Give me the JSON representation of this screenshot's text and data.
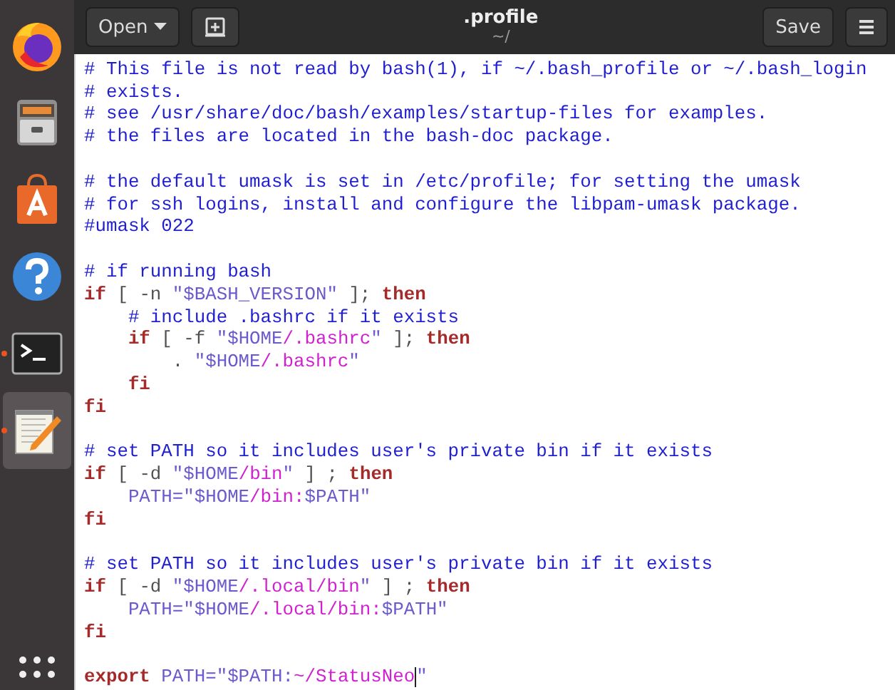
{
  "dock": {
    "items": [
      {
        "kind": "browser",
        "selected": false,
        "running": false
      },
      {
        "kind": "files",
        "selected": false,
        "running": false
      },
      {
        "kind": "software",
        "selected": false,
        "running": false
      },
      {
        "kind": "help",
        "selected": false,
        "running": false
      },
      {
        "kind": "terminal",
        "selected": false,
        "running": true
      },
      {
        "kind": "editor",
        "selected": true,
        "running": true
      }
    ],
    "apps_button": {
      "kind": "grid"
    }
  },
  "header": {
    "open_button": "Open",
    "title": ".profile",
    "subtitle": "~/",
    "save_button": "Save"
  },
  "editor": {
    "lines": [
      {
        "kind": "code",
        "segments": [
          {
            "kind": "comment",
            "text": "# This file is not read by bash(1), if ~/.bash_profile or ~/.bash_login"
          }
        ]
      },
      {
        "kind": "code",
        "segments": [
          {
            "kind": "comment",
            "text": "# exists."
          }
        ]
      },
      {
        "kind": "code",
        "segments": [
          {
            "kind": "comment",
            "text": "# see /usr/share/doc/bash/examples/startup-files for examples."
          }
        ]
      },
      {
        "kind": "code",
        "segments": [
          {
            "kind": "comment",
            "text": "# the files are located in the bash-doc package."
          }
        ]
      },
      {
        "kind": "blank"
      },
      {
        "kind": "code",
        "segments": [
          {
            "kind": "comment",
            "text": "# the default umask is set in /etc/profile; for setting the umask"
          }
        ]
      },
      {
        "kind": "code",
        "segments": [
          {
            "kind": "comment",
            "text": "# for ssh logins, install and configure the libpam-umask package."
          }
        ]
      },
      {
        "kind": "code",
        "segments": [
          {
            "kind": "comment",
            "text": "#umask 022"
          }
        ]
      },
      {
        "kind": "blank"
      },
      {
        "kind": "code",
        "segments": [
          {
            "kind": "comment",
            "text": "# if running bash"
          }
        ]
      },
      {
        "kind": "code",
        "segments": [
          {
            "kind": "keyword",
            "text": "if"
          },
          {
            "kind": "plain",
            "text": " [ -n "
          },
          {
            "kind": "variable",
            "text": "\"$BASH_VERSION\""
          },
          {
            "kind": "plain",
            "text": " ]; "
          },
          {
            "kind": "keyword",
            "text": "then"
          }
        ]
      },
      {
        "kind": "code",
        "segments": [
          {
            "kind": "comment",
            "text": "    # include .bashrc if it exists"
          }
        ]
      },
      {
        "kind": "code",
        "segments": [
          {
            "kind": "keyword",
            "text": "    if"
          },
          {
            "kind": "plain",
            "text": " [ -f "
          },
          {
            "kind": "variable",
            "text": "\"$HOME"
          },
          {
            "kind": "string",
            "text": "/.bashrc"
          },
          {
            "kind": "variable",
            "text": "\""
          },
          {
            "kind": "plain",
            "text": " ]; "
          },
          {
            "kind": "keyword",
            "text": "then"
          }
        ]
      },
      {
        "kind": "code",
        "segments": [
          {
            "kind": "plain",
            "text": "        . "
          },
          {
            "kind": "variable",
            "text": "\"$HOME"
          },
          {
            "kind": "string",
            "text": "/.bashrc"
          },
          {
            "kind": "variable",
            "text": "\""
          }
        ]
      },
      {
        "kind": "code",
        "segments": [
          {
            "kind": "keyword",
            "text": "    fi"
          }
        ]
      },
      {
        "kind": "code",
        "segments": [
          {
            "kind": "keyword",
            "text": "fi"
          }
        ]
      },
      {
        "kind": "blank"
      },
      {
        "kind": "code",
        "segments": [
          {
            "kind": "comment",
            "text": "# set PATH so it includes user's private bin if it exists"
          }
        ]
      },
      {
        "kind": "code",
        "segments": [
          {
            "kind": "keyword",
            "text": "if"
          },
          {
            "kind": "plain",
            "text": " [ -d "
          },
          {
            "kind": "variable",
            "text": "\"$HOME"
          },
          {
            "kind": "string",
            "text": "/bin"
          },
          {
            "kind": "variable",
            "text": "\""
          },
          {
            "kind": "plain",
            "text": " ] ; "
          },
          {
            "kind": "keyword",
            "text": "then"
          }
        ]
      },
      {
        "kind": "code",
        "segments": [
          {
            "kind": "variable",
            "text": "    PATH=\"$HOME"
          },
          {
            "kind": "string",
            "text": "/bin:"
          },
          {
            "kind": "variable",
            "text": "$PATH\""
          }
        ]
      },
      {
        "kind": "code",
        "segments": [
          {
            "kind": "keyword",
            "text": "fi"
          }
        ]
      },
      {
        "kind": "blank"
      },
      {
        "kind": "code",
        "segments": [
          {
            "kind": "comment",
            "text": "# set PATH so it includes user's private bin if it exists"
          }
        ]
      },
      {
        "kind": "code",
        "segments": [
          {
            "kind": "keyword",
            "text": "if"
          },
          {
            "kind": "plain",
            "text": " [ -d "
          },
          {
            "kind": "variable",
            "text": "\"$HOME"
          },
          {
            "kind": "string",
            "text": "/.local/bin"
          },
          {
            "kind": "variable",
            "text": "\""
          },
          {
            "kind": "plain",
            "text": " ] ; "
          },
          {
            "kind": "keyword",
            "text": "then"
          }
        ]
      },
      {
        "kind": "code",
        "segments": [
          {
            "kind": "variable",
            "text": "    PATH=\"$HOME"
          },
          {
            "kind": "string",
            "text": "/.local/bin:"
          },
          {
            "kind": "variable",
            "text": "$PATH\""
          }
        ]
      },
      {
        "kind": "code",
        "segments": [
          {
            "kind": "keyword",
            "text": "fi"
          }
        ]
      },
      {
        "kind": "blank"
      },
      {
        "kind": "code",
        "segments": [
          {
            "kind": "keyword",
            "text": "export"
          },
          {
            "kind": "variable",
            "text": " PATH=\"$PATH:"
          },
          {
            "kind": "string",
            "text": "~/StatusNeo"
          },
          {
            "kind": "cursor"
          },
          {
            "kind": "variable",
            "text": "\""
          }
        ]
      }
    ]
  }
}
